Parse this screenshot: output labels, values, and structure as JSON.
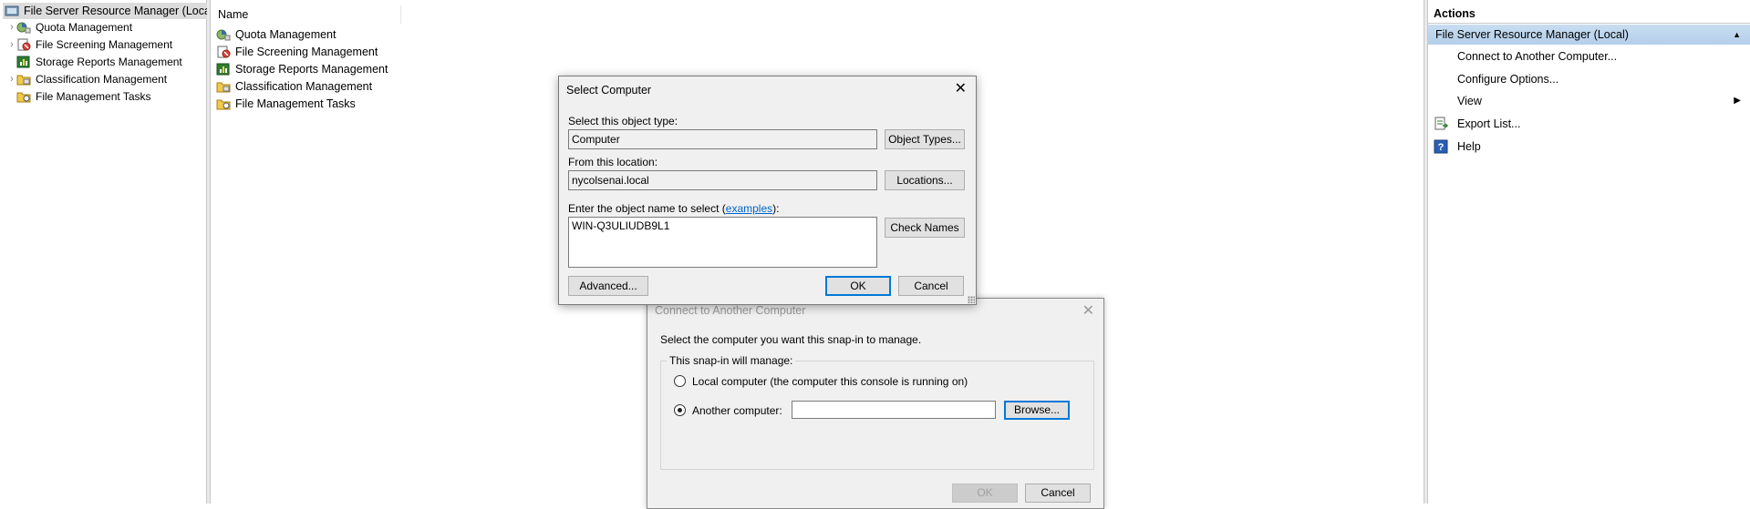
{
  "tree": {
    "root_label": "File Server Resource Manager (Local)",
    "items": [
      {
        "label": "Quota Management",
        "icon": "quota-icon",
        "expandable": true
      },
      {
        "label": "File Screening Management",
        "icon": "file-screening-icon",
        "expandable": true
      },
      {
        "label": "Storage Reports Management",
        "icon": "storage-reports-icon",
        "expandable": false
      },
      {
        "label": "Classification Management",
        "icon": "classification-icon",
        "expandable": true
      },
      {
        "label": "File Management Tasks",
        "icon": "file-management-tasks-icon",
        "expandable": false
      }
    ]
  },
  "list": {
    "column_name": "Name",
    "rows": [
      {
        "label": "Quota Management"
      },
      {
        "label": "File Screening Management"
      },
      {
        "label": "Storage Reports Management"
      },
      {
        "label": "Classification Management"
      },
      {
        "label": "File Management Tasks"
      }
    ]
  },
  "actions": {
    "header": "Actions",
    "section": "File Server Resource Manager (Local)",
    "items": [
      {
        "label": "Connect to Another Computer..."
      },
      {
        "label": "Configure Options..."
      },
      {
        "label": "View"
      },
      {
        "label": "Export List..."
      },
      {
        "label": "Help"
      }
    ]
  },
  "connect_dialog": {
    "title": "Connect to Another Computer",
    "prompt": "Select the computer you want this snap-in to manage.",
    "group_label": "This snap-in will manage:",
    "option_local": "Local computer (the computer this console is running on)",
    "option_another": "Another computer:",
    "selected_option": "another",
    "computer_value": "",
    "browse_label": "Browse...",
    "ok_label": "OK",
    "cancel_label": "Cancel"
  },
  "select_dialog": {
    "title": "Select Computer",
    "object_type_label": "Select this object type:",
    "object_type_value": "Computer",
    "object_types_button": "Object Types...",
    "location_label": "From this location:",
    "location_value": "nycolsenai.local",
    "locations_button": "Locations...",
    "name_label_prefix": "Enter the object name to select (",
    "examples_link": "examples",
    "name_label_suffix": "):",
    "name_value": "WIN-Q3ULIUDB9L1",
    "check_names_button": "Check Names",
    "advanced_button": "Advanced...",
    "ok_label": "OK",
    "cancel_label": "Cancel"
  },
  "colors": {
    "selection_bg": "#dcdcdc",
    "actions_section_bg": "#c8ddf1",
    "default_button_border": "#0078d7",
    "link": "#0066cc"
  }
}
